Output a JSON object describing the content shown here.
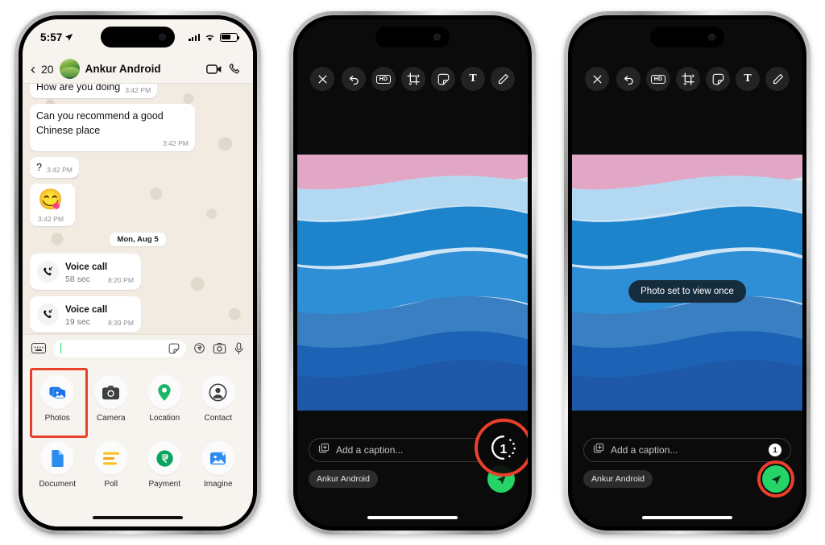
{
  "phone1": {
    "status_bar": {
      "time": "5:57",
      "location_icon": "location-arrow-icon",
      "signal_icon": "cellular-bars-icon",
      "wifi_icon": "wifi-icon",
      "battery_icon": "battery-icon"
    },
    "header": {
      "back_icon": "chevron-left-icon",
      "unread_count": "20",
      "avatar_name": "contact-avatar",
      "contact_name": "Ankur Android",
      "video_icon": "video-call-icon",
      "call_icon": "phone-call-icon"
    },
    "messages": [
      {
        "text": "How are you doing",
        "time": "3:42 PM",
        "layout": "inline"
      },
      {
        "text": "Can you recommend a good Chinese place",
        "time": "3:42 PM",
        "layout": "block"
      },
      {
        "text": "?",
        "time": "3:42 PM",
        "layout": "inline"
      },
      {
        "emoji": "😋",
        "time": "3:42 PM",
        "layout": "emoji"
      }
    ],
    "date_divider": "Mon, Aug 5",
    "calls": [
      {
        "title": "Voice call",
        "duration": "58 sec",
        "time": "8:20 PM",
        "icon": "incoming-call-icon"
      },
      {
        "title": "Voice call",
        "duration": "19 sec",
        "time": "8:39 PM",
        "icon": "incoming-call-icon"
      }
    ],
    "input_row": {
      "keyboard_icon": "keyboard-icon",
      "message_value": "",
      "sticker_icon": "sticker-icon",
      "payment_icon": "rupee-icon",
      "camera_icon": "camera-icon",
      "mic_icon": "microphone-icon"
    },
    "attachments": [
      {
        "label": "Photos",
        "icon": "photos-icon",
        "highlighted": true
      },
      {
        "label": "Camera",
        "icon": "camera-icon",
        "highlighted": false
      },
      {
        "label": "Location",
        "icon": "location-pin-icon",
        "highlighted": false
      },
      {
        "label": "Contact",
        "icon": "contact-person-icon",
        "highlighted": false
      },
      {
        "label": "Document",
        "icon": "document-icon",
        "highlighted": false
      },
      {
        "label": "Poll",
        "icon": "poll-icon",
        "highlighted": false
      },
      {
        "label": "Payment",
        "icon": "rupee-circle-icon",
        "highlighted": false
      },
      {
        "label": "Imagine",
        "icon": "imagine-ai-icon",
        "highlighted": false
      }
    ]
  },
  "editor_toolbar": {
    "close_icon": "close-icon",
    "undo_icon": "undo-icon",
    "hd_label": "HD",
    "crop_icon": "crop-icon",
    "sticker_icon": "sticker-icon",
    "text_label": "T",
    "draw_icon": "pencil-icon"
  },
  "phone2": {
    "caption_placeholder": "Add a caption...",
    "caption_value": "",
    "album_icon": "add-media-icon",
    "recipient": "Ankur Android",
    "view_once_state": "off",
    "view_once_label": "1",
    "send_icon": "send-icon",
    "annotation": "view-once-button-highlight"
  },
  "phone3": {
    "caption_placeholder": "Add a caption...",
    "caption_value": "",
    "album_icon": "add-media-icon",
    "recipient": "Ankur Android",
    "toast": "Photo set to view once",
    "view_once_state": "on",
    "view_once_label": "1",
    "send_icon": "send-icon",
    "annotation": "send-button-highlight"
  },
  "colors": {
    "highlight": "#e8402a",
    "send_green": "#25d366",
    "chat_background": "#f1ebe2",
    "editor_background": "#0b0b0b"
  }
}
